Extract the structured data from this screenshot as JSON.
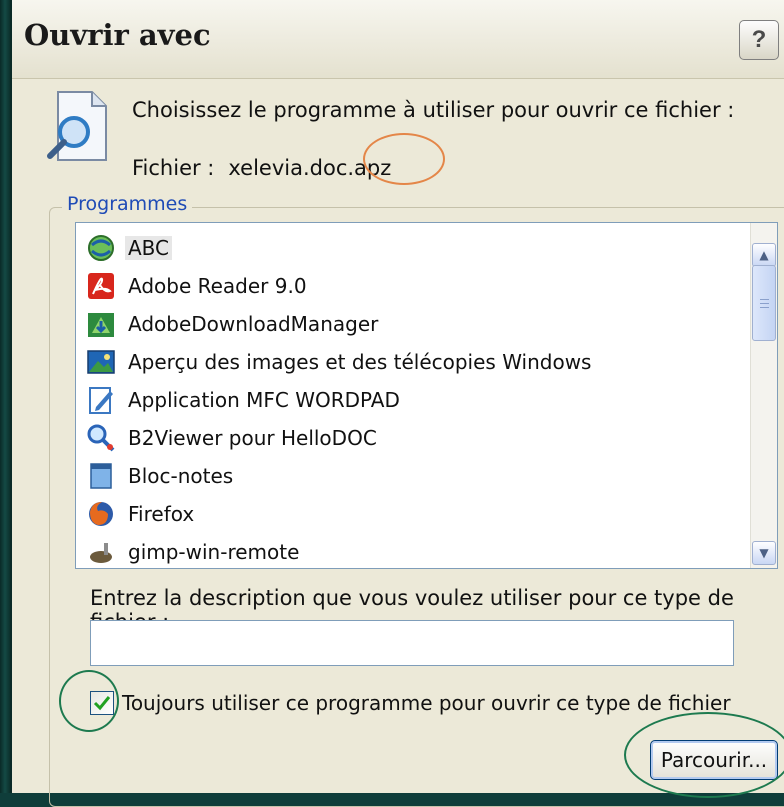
{
  "window": {
    "title": "Ouvrir avec",
    "help_label": "?"
  },
  "header": {
    "prompt": "Choisissez le programme à utiliser pour ouvrir ce fichier :",
    "file_label": "Fichier :",
    "file_name": "xelevia.doc.apz"
  },
  "programs": {
    "group_label": "Programmes",
    "items": [
      {
        "label": "ABC",
        "icon": "abc-icon",
        "selected": true
      },
      {
        "label": "Adobe Reader 9.0",
        "icon": "adobe-reader-icon"
      },
      {
        "label": "AdobeDownloadManager",
        "icon": "adobe-download-manager-icon"
      },
      {
        "label": "Aperçu des images et des télécopies Windows",
        "icon": "image-viewer-icon"
      },
      {
        "label": "Application MFC WORDPAD",
        "icon": "wordpad-icon"
      },
      {
        "label": "B2Viewer pour HelloDOC",
        "icon": "b2viewer-icon"
      },
      {
        "label": "Bloc-notes",
        "icon": "notepad-icon"
      },
      {
        "label": "Firefox",
        "icon": "firefox-icon"
      },
      {
        "label": "gimp-win-remote",
        "icon": "gimp-icon"
      }
    ]
  },
  "description": {
    "label": "Entrez la description que vous voulez utiliser pour ce type de fichier :",
    "value": ""
  },
  "always_use": {
    "label": "Toujours utiliser ce programme pour ouvrir ce type de fichier",
    "checked": true
  },
  "buttons": {
    "browse": "Parcourir..."
  },
  "colors": {
    "dialog_bg": "#ece9d8",
    "group_label": "#1f4bb6",
    "annotation_orange": "#e48648",
    "annotation_green": "#1d7a4f"
  }
}
